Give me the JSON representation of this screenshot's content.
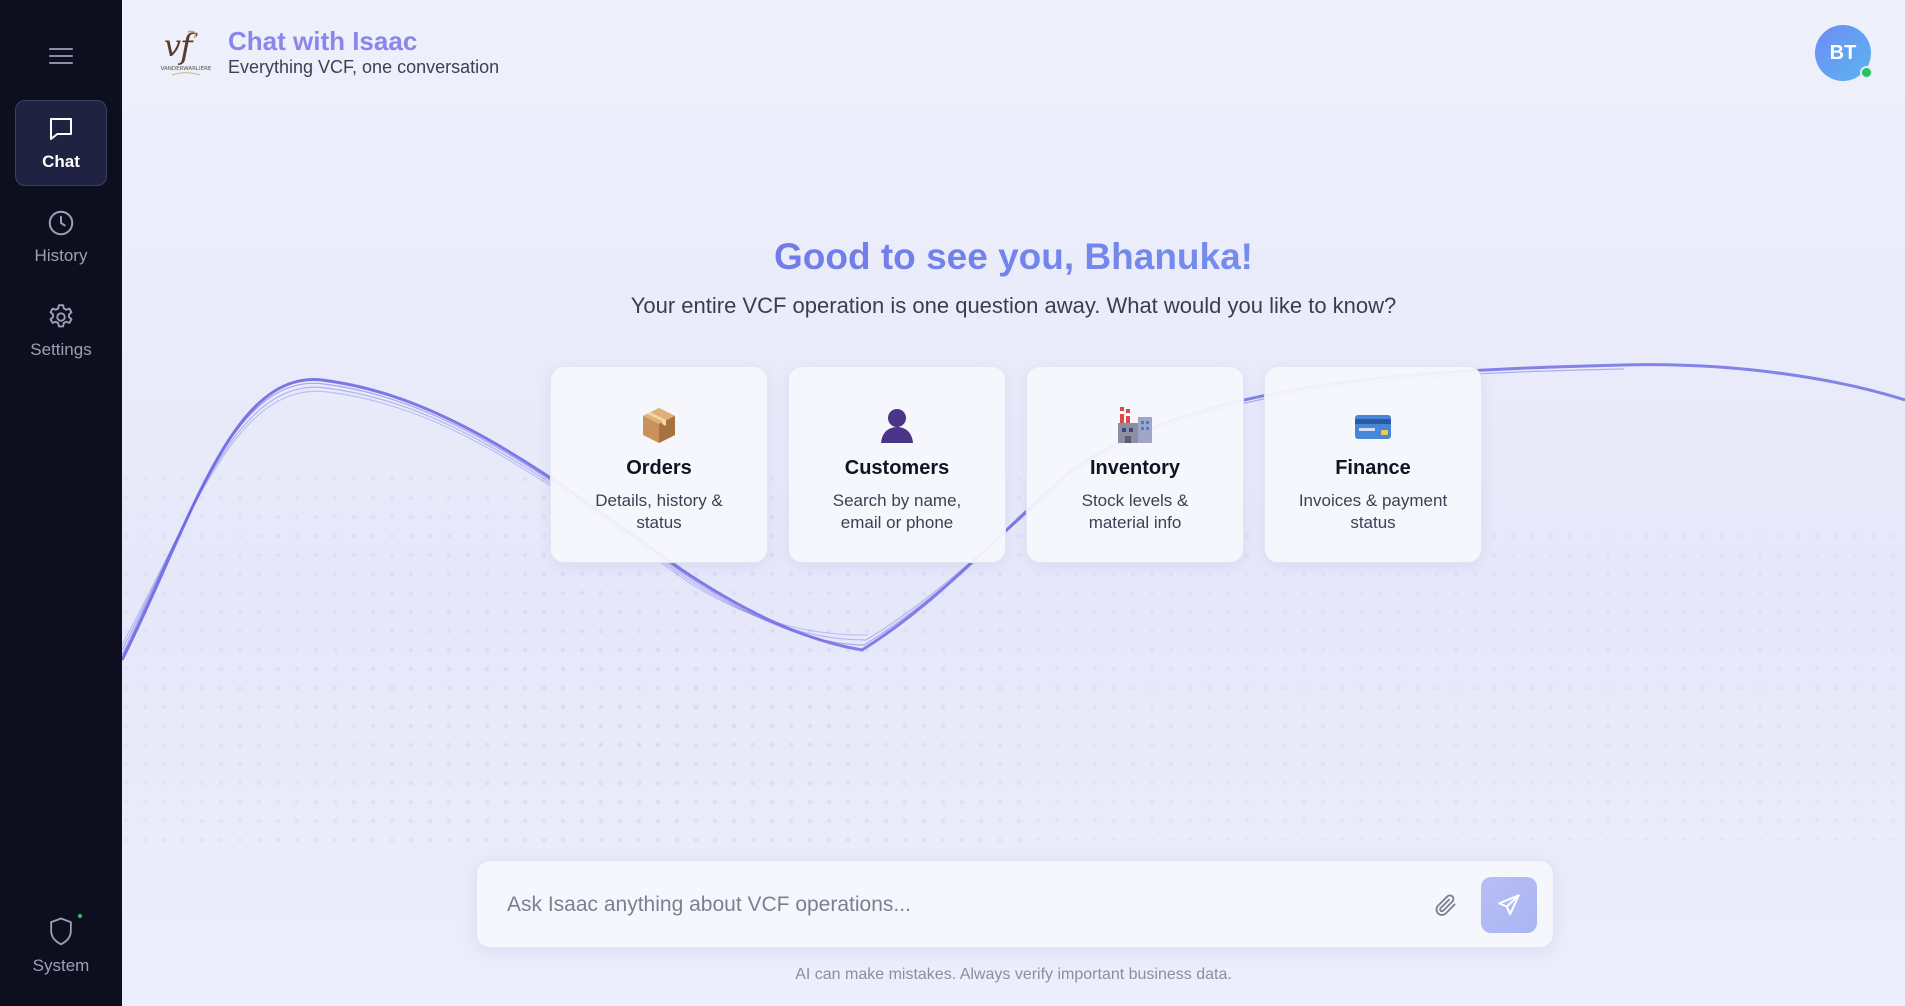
{
  "sidebar": {
    "items": [
      {
        "label": "Chat",
        "icon": "chat-bubble-icon",
        "active": true
      },
      {
        "label": "History",
        "icon": "clock-icon",
        "active": false
      },
      {
        "label": "Settings",
        "icon": "gear-icon",
        "active": false
      }
    ],
    "system_label": "System"
  },
  "header": {
    "title": "Chat with Isaac",
    "subtitle": "Everything VCF, one conversation",
    "logo_text": "VANDERWARLIERE"
  },
  "user": {
    "initials": "BT",
    "online": true
  },
  "hero": {
    "greeting": "Good to see you, Bhanuka!",
    "subtitle": "Your entire VCF operation is one question away. What would you like to know?"
  },
  "cards": [
    {
      "icon": "package-icon",
      "title": "Orders",
      "description": "Details, history & status"
    },
    {
      "icon": "person-icon",
      "title": "Customers",
      "description": "Search by name, email or phone"
    },
    {
      "icon": "factory-icon",
      "title": "Inventory",
      "description": "Stock levels & material info"
    },
    {
      "icon": "credit-card-icon",
      "title": "Finance",
      "description": "Invoices & payment status"
    }
  ],
  "composer": {
    "placeholder": "Ask Isaac anything about VCF operations..."
  },
  "footer": {
    "disclaimer": "AI can make mistakes. Always verify important business data."
  },
  "colors": {
    "sidebar_bg": "#0d0f1f",
    "accent": "#8b86ec",
    "greeting_start": "#6c63e8",
    "greeting_end": "#7aa5ef",
    "online": "#22c55e"
  }
}
